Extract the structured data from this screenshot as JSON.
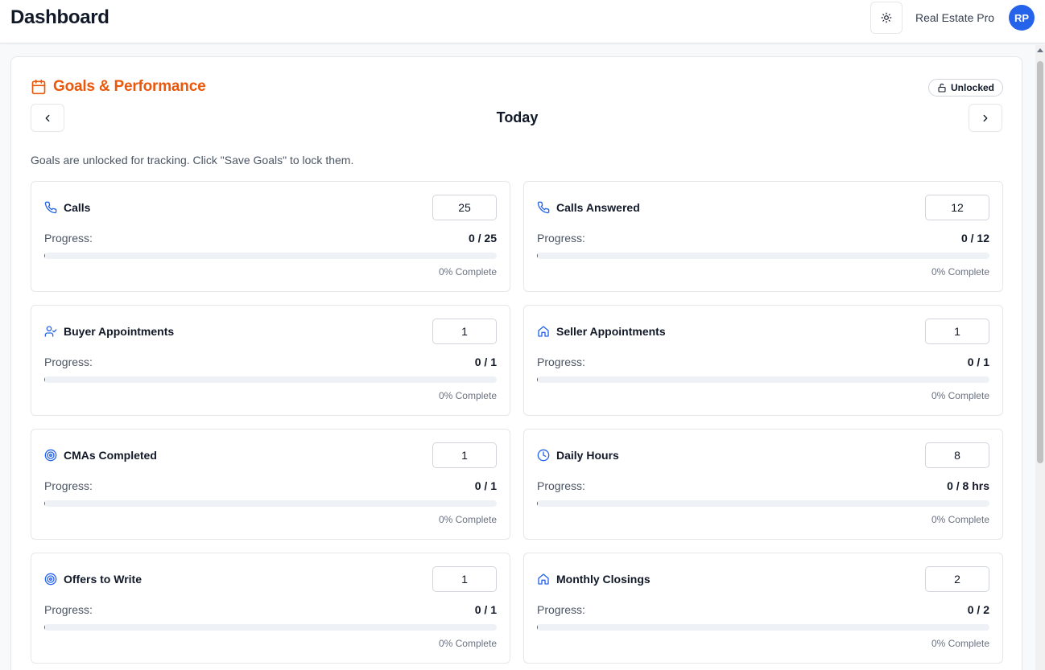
{
  "header": {
    "title": "Dashboard",
    "brand": "Real Estate Pro",
    "avatar_initials": "RP",
    "theme_icon": "sun-icon"
  },
  "panel": {
    "title": "Goals & Performance",
    "title_icon": "calendar-icon",
    "lock_status": "Unlocked",
    "lock_icon": "unlock-icon",
    "period": "Today",
    "notice": "Goals are unlocked for tracking. Click \"Save Goals\" to lock them.",
    "progress_label": "Progress:",
    "accent_color": "#ea580c",
    "icon_color": "#2563eb"
  },
  "goals": [
    {
      "label": "Calls",
      "icon": "phone-icon",
      "target": "25",
      "progress_text": "0 / 25",
      "percent_text": "0% Complete",
      "percent": 0
    },
    {
      "label": "Calls Answered",
      "icon": "phone-icon",
      "target": "12",
      "progress_text": "0 / 12",
      "percent_text": "0% Complete",
      "percent": 0
    },
    {
      "label": "Buyer Appointments",
      "icon": "user-check-icon",
      "target": "1",
      "progress_text": "0 / 1",
      "percent_text": "0% Complete",
      "percent": 0
    },
    {
      "label": "Seller Appointments",
      "icon": "home-icon",
      "target": "1",
      "progress_text": "0 / 1",
      "percent_text": "0% Complete",
      "percent": 0
    },
    {
      "label": "CMAs Completed",
      "icon": "target-icon",
      "target": "1",
      "progress_text": "0 / 1",
      "percent_text": "0% Complete",
      "percent": 0
    },
    {
      "label": "Daily Hours",
      "icon": "clock-icon",
      "target": "8",
      "progress_text": "0 / 8 hrs",
      "percent_text": "0% Complete",
      "percent": 0
    },
    {
      "label": "Offers to Write",
      "icon": "target-icon",
      "target": "1",
      "progress_text": "0 / 1",
      "percent_text": "0% Complete",
      "percent": 0
    },
    {
      "label": "Monthly Closings",
      "icon": "home-icon",
      "target": "2",
      "progress_text": "0 / 2",
      "percent_text": "0% Complete",
      "percent": 0
    }
  ]
}
